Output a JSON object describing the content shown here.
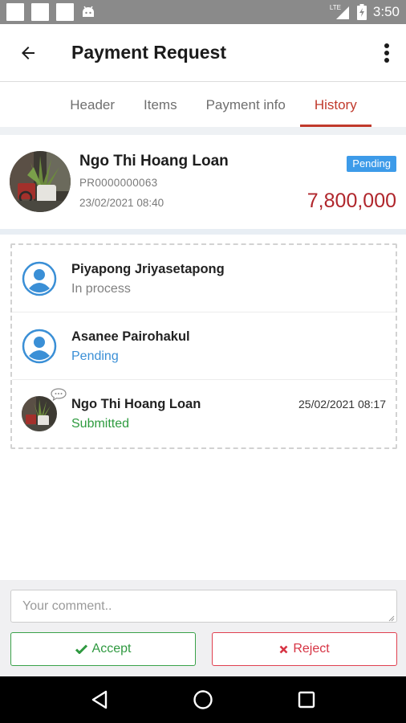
{
  "status_bar": {
    "network": "LTE",
    "time": "3:50"
  },
  "app_bar": {
    "title": "Payment Request"
  },
  "tabs": [
    {
      "label": "Header",
      "active": false
    },
    {
      "label": "Items",
      "active": false
    },
    {
      "label": "Payment info",
      "active": false
    },
    {
      "label": "History",
      "active": true
    }
  ],
  "summary": {
    "name": "Ngo Thi Hoang Loan",
    "code": "PR0000000063",
    "date": "23/02/2021 08:40",
    "status_badge": "Pending",
    "amount": "7,800,000"
  },
  "history": [
    {
      "name": "Piyapong Jriyasetapong",
      "status": "In process",
      "status_color": "#808080",
      "time": "",
      "avatar": "placeholder-user"
    },
    {
      "name": "Asanee Pairohakul",
      "status": "Pending",
      "status_color": "#3a8fd6",
      "time": "",
      "avatar": "placeholder-user"
    },
    {
      "name": "Ngo Thi Hoang Loan",
      "status": "Submitted",
      "status_color": "#2e9b3f",
      "time": "25/02/2021 08:17",
      "avatar": "photo"
    }
  ],
  "comment": {
    "placeholder": "Your comment..",
    "value": ""
  },
  "actions": {
    "accept_label": "Accept",
    "reject_label": "Reject"
  },
  "colors": {
    "accent": "#c0392b",
    "badge": "#3d9be9",
    "amount": "#b0262c",
    "accept": "#2f9940",
    "reject": "#d63343"
  }
}
